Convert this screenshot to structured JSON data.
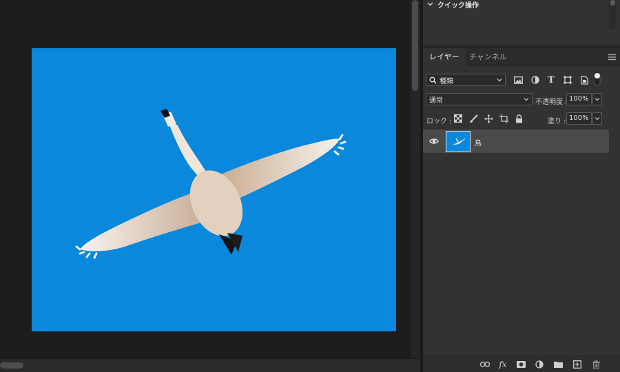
{
  "quick_actions": {
    "title": "クイック操作"
  },
  "layers_panel": {
    "tabs": [
      {
        "label": "レイヤー",
        "active": true
      },
      {
        "label": "チャンネル",
        "active": false
      }
    ],
    "filter": {
      "value": "種類"
    },
    "blend_mode": {
      "value": "通常"
    },
    "opacity": {
      "label": "不透明度 :",
      "value": "100%"
    },
    "lock": {
      "label": "ロック :"
    },
    "fill": {
      "label": "塗り :",
      "value": "100%"
    },
    "layers": [
      {
        "name": "鳥",
        "visible": true,
        "selected": true
      }
    ],
    "filter_icons": [
      "image-filter-icon",
      "adjustment-filter-icon",
      "type-filter-icon",
      "shape-filter-icon",
      "smart-object-filter-icon",
      "filter-toggle-icon"
    ],
    "lock_icons": [
      "lock-transparent-pixels-icon",
      "lock-image-pixels-icon",
      "lock-position-icon",
      "lock-artboard-icon",
      "lock-all-icon"
    ],
    "footer_icons": [
      "link-layers-icon",
      "fx-icon",
      "mask-icon",
      "adjustment-layer-icon",
      "group-folder-icon",
      "new-layer-icon",
      "delete-layer-icon"
    ]
  },
  "colors": {
    "sky": "#0a88dc",
    "panel": "#323232",
    "canvas_bg": "#1d1d1d",
    "selected_row": "#4a4a4a"
  }
}
